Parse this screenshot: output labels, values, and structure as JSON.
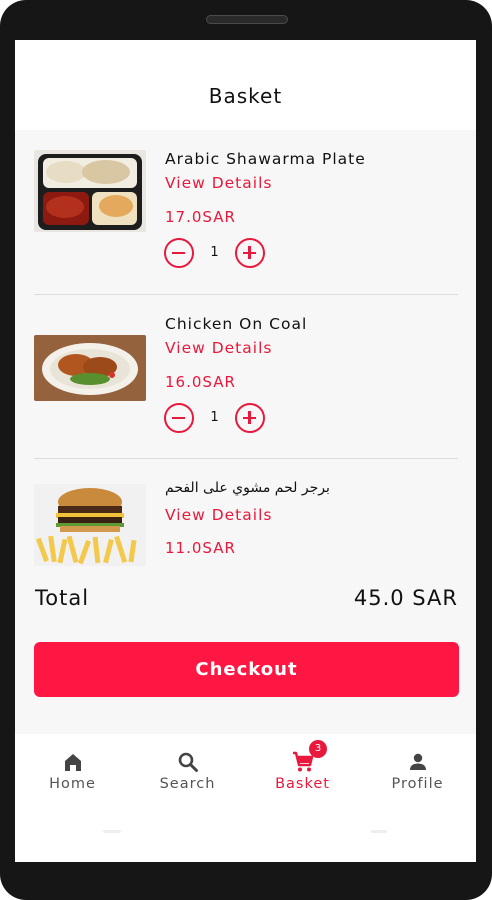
{
  "header": {
    "title": "Basket"
  },
  "items": [
    {
      "name": "Arabic Shawarma Plate",
      "view_details": "View Details",
      "price": "17.0SAR",
      "quantity": "1",
      "image": "shawarma-plate-photo"
    },
    {
      "name": "Chicken On Coal",
      "view_details": "View Details",
      "price": "16.0SAR",
      "quantity": "1",
      "image": "chicken-plate-photo"
    },
    {
      "name": "برجر لحم مشوي على الفحم",
      "view_details": "View Details",
      "price": "11.0SAR",
      "image": "burger-fries-photo"
    }
  ],
  "total": {
    "label": "Total",
    "value": "45.0 SAR"
  },
  "checkout": {
    "label": "Checkout"
  },
  "nav": {
    "items": [
      {
        "label": "Home",
        "icon": "home-icon"
      },
      {
        "label": "Search",
        "icon": "search-icon"
      },
      {
        "label": "Basket",
        "icon": "cart-icon",
        "badge": "3",
        "active": true
      },
      {
        "label": "Profile",
        "icon": "person-icon"
      }
    ]
  },
  "colors": {
    "accent": "#e8193c",
    "checkout_bg": "#ff1744",
    "background": "#f7f7f7",
    "frame": "#161616"
  }
}
